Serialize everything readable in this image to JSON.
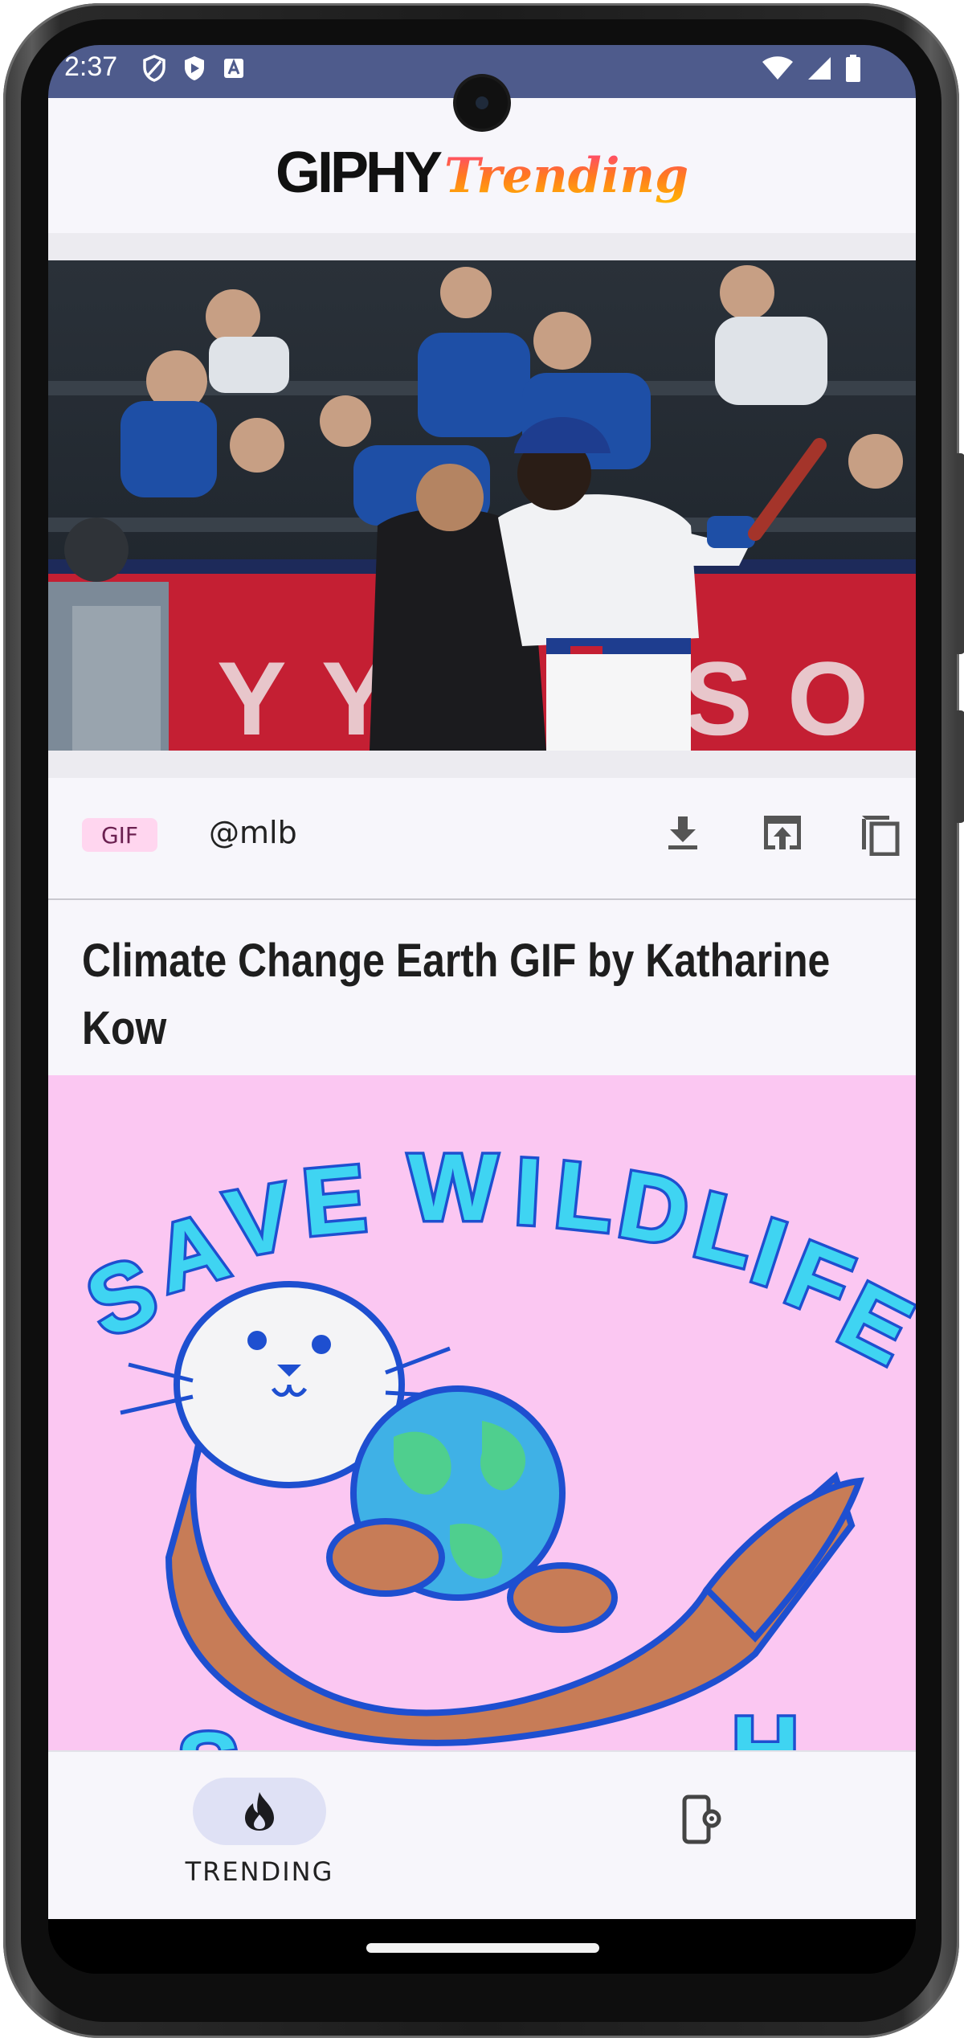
{
  "status_bar": {
    "time": "2:37"
  },
  "app_header": {
    "logo_primary": "GIPHY",
    "logo_secondary": "Trending"
  },
  "feed": {
    "items": [
      {
        "badge": "GIF",
        "username": "@mlb"
      },
      {
        "title": "Climate Change Earth GIF by Katharine Kow"
      }
    ]
  },
  "bottom_nav": {
    "trending_label": "TRENDING"
  },
  "colors": {
    "status_bar_bg": "#4e5b8c",
    "badge_bg": "#ffd6ef",
    "nav_pill_bg": "#dfe1f5",
    "gif2_bg": "#fbc7f2"
  },
  "icons": [
    "shield-icon",
    "play-protect-icon",
    "keyboard-a-icon",
    "wifi-icon",
    "signal-icon",
    "battery-icon",
    "download-icon",
    "open-in-app-icon",
    "copy-icon",
    "flame-icon",
    "phone-settings-icon"
  ]
}
